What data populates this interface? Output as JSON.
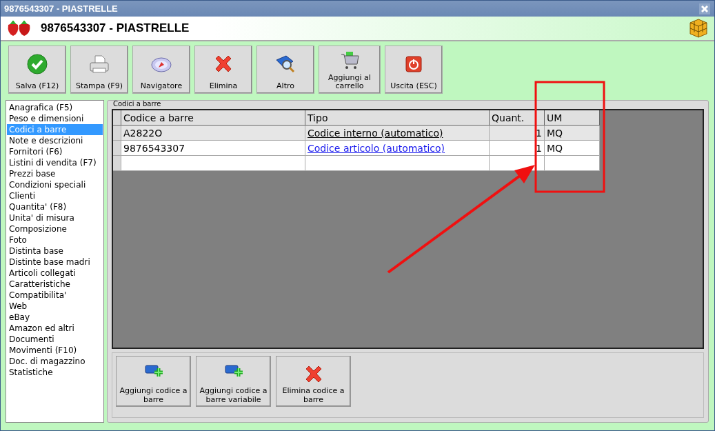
{
  "window": {
    "title": "9876543307 - PIASTRELLE"
  },
  "header": {
    "title": "9876543307 - PIASTRELLE"
  },
  "toolbar": [
    {
      "label": "Salva (F12)",
      "kind": "check"
    },
    {
      "label": "Stampa (F9)",
      "kind": "printer"
    },
    {
      "label": "Navigatore",
      "kind": "compass"
    },
    {
      "label": "Elimina",
      "kind": "cross"
    },
    {
      "label": "Altro",
      "kind": "book"
    },
    {
      "label": "Aggiungi al carrello",
      "kind": "cart"
    },
    {
      "label": "Uscita (ESC)",
      "kind": "power"
    }
  ],
  "sidebar": {
    "items": [
      {
        "label": "Anagrafica (F5)",
        "selected": false
      },
      {
        "label": "Peso e dimensioni",
        "selected": false
      },
      {
        "label": "Codici a barre",
        "selected": true
      },
      {
        "label": "Note e descrizioni",
        "selected": false
      },
      {
        "label": "Fornitori (F6)",
        "selected": false
      },
      {
        "label": "Listini di vendita (F7)",
        "selected": false
      },
      {
        "label": "Prezzi base",
        "selected": false
      },
      {
        "label": "Condizioni speciali",
        "selected": false
      },
      {
        "label": "Clienti",
        "selected": false
      },
      {
        "label": "Quantita' (F8)",
        "selected": false
      },
      {
        "label": "Unita' di misura",
        "selected": false
      },
      {
        "label": "Composizione",
        "selected": false
      },
      {
        "label": "Foto",
        "selected": false
      },
      {
        "label": "Distinta base",
        "selected": false
      },
      {
        "label": "Distinte base madri",
        "selected": false
      },
      {
        "label": "Articoli collegati",
        "selected": false
      },
      {
        "label": "Caratteristiche",
        "selected": false
      },
      {
        "label": "Compatibilita'",
        "selected": false
      },
      {
        "label": "Web",
        "selected": false
      },
      {
        "label": "eBay",
        "selected": false
      },
      {
        "label": "Amazon ed altri",
        "selected": false
      },
      {
        "label": "Documenti",
        "selected": false
      },
      {
        "label": "Movimenti (F10)",
        "selected": false
      },
      {
        "label": "Doc. di magazzino",
        "selected": false
      },
      {
        "label": "Statistiche",
        "selected": false
      }
    ]
  },
  "group": {
    "title": "Codici a barre"
  },
  "table": {
    "columns": [
      "Codice a barre",
      "Tipo",
      "Quant.",
      "UM"
    ],
    "rows": [
      {
        "cells": [
          "A2822O",
          "Codice interno (automatico)",
          "1",
          "MQ"
        ],
        "selected": true
      },
      {
        "cells": [
          "9876543307",
          "Codice articolo (automatico)",
          "1",
          "MQ"
        ],
        "selected": false
      }
    ]
  },
  "actions": [
    {
      "label": "Aggiungi codice a barre",
      "kind": "add"
    },
    {
      "label": "Aggiungi codice a barre variabile",
      "kind": "add"
    },
    {
      "label": "Elimina codice a barre",
      "kind": "cross"
    }
  ]
}
